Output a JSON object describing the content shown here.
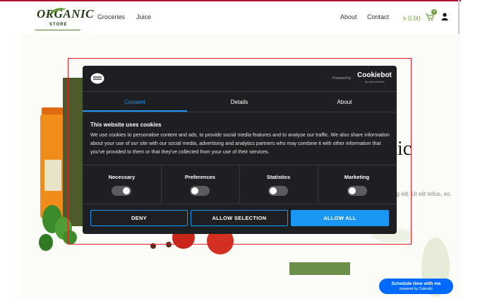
{
  "brand": {
    "name": "ORGANIC",
    "sub": "STORE"
  },
  "nav": {
    "left": [
      "Groceries",
      "Juice"
    ],
    "right": [
      "About",
      "Contact"
    ],
    "cart_total": "0.00",
    "cart_count": "0"
  },
  "hero": {
    "title_fragment": "nic",
    "text_fragment": "ng elit. Ut elit tellus, eo."
  },
  "cookie_dialog": {
    "powered_by": "Powered by",
    "provider": "Cookiebot",
    "provider_sub": "by Usercentrics",
    "tabs": [
      "Consent",
      "Details",
      "About"
    ],
    "active_tab": "Consent",
    "heading": "This website uses cookies",
    "body": "We use cookies to personalise content and ads, to provide social media features and to analyse our traffic. We also share information about your use of our site with our social media, advertising and analytics partners who may combine it with other information that you've provided to them or that they've collected from your use of their services.",
    "categories": [
      {
        "label": "Necessary",
        "enabled": true
      },
      {
        "label": "Preferences",
        "enabled": false
      },
      {
        "label": "Statistics",
        "enabled": false
      },
      {
        "label": "Marketing",
        "enabled": false
      }
    ],
    "buttons": {
      "deny": "DENY",
      "allow_selection": "ALLOW SELECTION",
      "allow_all": "ALLOW ALL"
    },
    "accent": "#1a96f5"
  },
  "calendly": {
    "title": "Schedule time with me",
    "sub": "powered by Calendly"
  }
}
